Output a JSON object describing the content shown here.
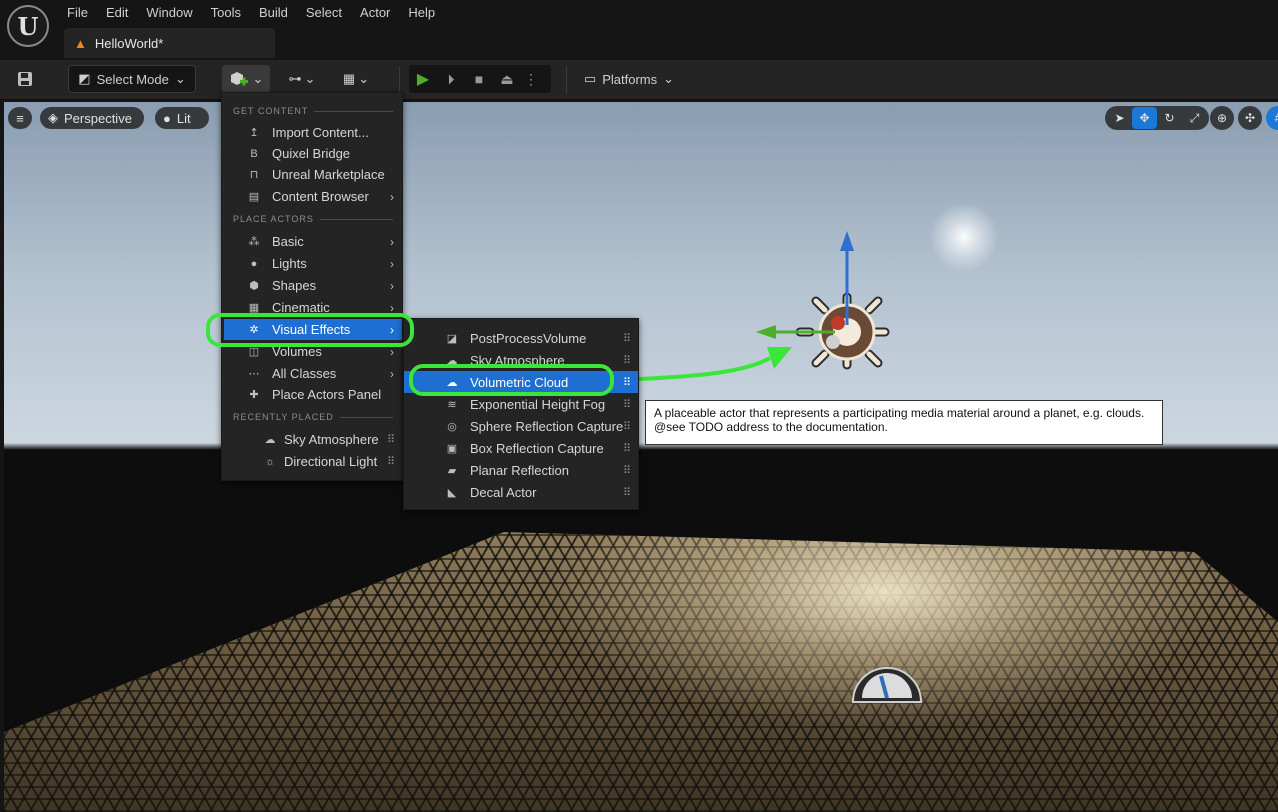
{
  "menu_bar": [
    "File",
    "Edit",
    "Window",
    "Tools",
    "Build",
    "Select",
    "Actor",
    "Help"
  ],
  "document_tab": {
    "label": "HelloWorld*"
  },
  "toolbar": {
    "select_mode_label": "Select Mode",
    "platforms_label": "Platforms"
  },
  "viewport": {
    "perspective_label": "Perspective",
    "lit_label": "Lit"
  },
  "add_menu": {
    "sections": {
      "get_content": "GET CONTENT",
      "place_actors": "PLACE ACTORS",
      "recently_placed": "RECENTLY PLACED"
    },
    "get_content_items": [
      "Import Content...",
      "Quixel Bridge",
      "Unreal Marketplace",
      "Content Browser"
    ],
    "place_actor_items": [
      "Basic",
      "Lights",
      "Shapes",
      "Cinematic",
      "Visual Effects",
      "Volumes",
      "All Classes",
      "Place Actors Panel"
    ],
    "recent_items": [
      "Sky Atmosphere",
      "Directional Light"
    ]
  },
  "vfx_menu": {
    "items": [
      "PostProcessVolume",
      "Sky Atmosphere",
      "Volumetric Cloud",
      "Exponential Height Fog",
      "Sphere Reflection Capture",
      "Box Reflection Capture",
      "Planar Reflection",
      "Decal Actor"
    ]
  },
  "tooltip": {
    "line1": "A placeable actor that represents a participating media material around a planet, e.g. clouds.",
    "line2": "@see TODO address to the documentation."
  },
  "colors": {
    "highlight": "#1e6fd1",
    "annotation": "#39e639",
    "play_green": "#4caf2a"
  }
}
